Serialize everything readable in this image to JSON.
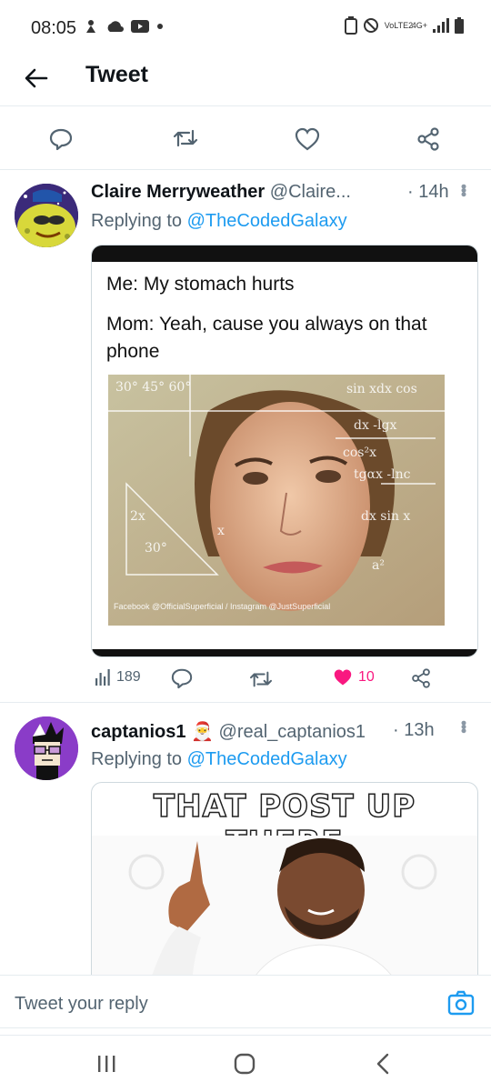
{
  "status_bar": {
    "time": "08:05",
    "network_labels": [
      "VoLTE2",
      "4G+"
    ]
  },
  "header": {
    "title": "Tweet"
  },
  "parent_actions": {
    "icons": [
      "reply-icon",
      "retweet-icon",
      "like-icon",
      "share-icon"
    ]
  },
  "tweets": [
    {
      "name": "Claire Merryweather",
      "handle": "@Claire...",
      "time": "· 14h",
      "replying_prefix": "Replying to ",
      "replying_to": "@TheCodedGalaxy",
      "meme_line1": "Me: My stomach hurts",
      "meme_line2": "Mom: Yeah, cause you always on that phone",
      "watermark": "Facebook @OfficialSuperficial / Instagram @JustSuperficial",
      "stats": {
        "views": "189",
        "likes": "10"
      },
      "accent": "#f91880"
    },
    {
      "name": "captanios1",
      "badge": "🎅",
      "handle": "@real_captanios1",
      "time": "· 13h",
      "replying_prefix": "Replying to ",
      "replying_to": "@TheCodedGalaxy",
      "meme_caption": "THAT POST UP THERE"
    }
  ],
  "composer": {
    "placeholder": "Tweet your reply"
  },
  "colors": {
    "link": "#1d9bf0",
    "muted": "#536471"
  }
}
